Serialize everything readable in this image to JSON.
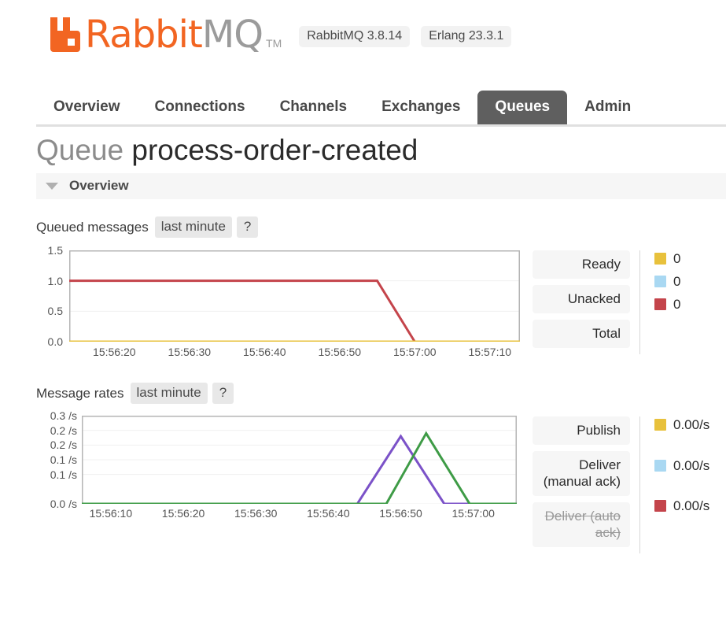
{
  "brand": {
    "name_part1": "Rabbit",
    "name_part2": "MQ",
    "trademark": "TM",
    "logo_icon": "rabbitmq-logo-icon",
    "orange": "#F26522",
    "grey": "#9b9b9b"
  },
  "versions": [
    {
      "label": "RabbitMQ 3.8.14"
    },
    {
      "label": "Erlang 23.3.1"
    }
  ],
  "nav": {
    "tabs": [
      {
        "label": "Overview",
        "active": false
      },
      {
        "label": "Connections",
        "active": false
      },
      {
        "label": "Channels",
        "active": false
      },
      {
        "label": "Exchanges",
        "active": false
      },
      {
        "label": "Queues",
        "active": true
      },
      {
        "label": "Admin",
        "active": false
      }
    ]
  },
  "page": {
    "title_prefix": "Queue",
    "queue_name": "process-order-created",
    "section": {
      "title": "Overview",
      "caret_icon": "caret-down-icon"
    }
  },
  "queued_messages": {
    "label": "Queued messages",
    "period": "last minute",
    "help": "?",
    "legend": [
      {
        "name": "Ready",
        "value": "0",
        "color": "#E8C13C",
        "disabled": false
      },
      {
        "name": "Unacked",
        "value": "0",
        "color": "#A9D8F2",
        "disabled": false
      },
      {
        "name": "Total",
        "value": "0",
        "color": "#C4444B",
        "disabled": false
      }
    ]
  },
  "message_rates": {
    "label": "Message rates",
    "period": "last minute",
    "help": "?",
    "legend": [
      {
        "name": "Publish",
        "value": "0.00/s",
        "color": "#E8C13C",
        "disabled": false
      },
      {
        "name": "Deliver (manual ack)",
        "value": "0.00/s",
        "color": "#A9D8F2",
        "disabled": false
      },
      {
        "name": "Deliver (auto ack)",
        "value": "0.00/s",
        "color": "#C4444B",
        "disabled": true
      }
    ]
  },
  "chart_data": [
    {
      "type": "line",
      "title": "Queued messages",
      "xlabel": "",
      "ylabel": "",
      "grid": true,
      "legend_position": "right",
      "ylim": [
        0,
        1.5
      ],
      "yticks": [
        "0.0",
        "0.5",
        "1.0",
        "1.5"
      ],
      "ytick_values": [
        0.0,
        0.5,
        1.0,
        1.5
      ],
      "xticks": [
        "15:56:20",
        "15:56:30",
        "15:56:40",
        "15:56:50",
        "15:57:00",
        "15:57:10"
      ],
      "xtick_values": [
        20,
        30,
        40,
        50,
        60,
        70
      ],
      "xlim": [
        14,
        74
      ],
      "series": [
        {
          "name": "Total",
          "color": "#C4444B",
          "x": [
            14,
            55,
            60,
            74
          ],
          "values": [
            1.0,
            1.0,
            0.0,
            0.0
          ]
        },
        {
          "name": "Unacked",
          "color": "#A9D8F2",
          "x": [
            14,
            74
          ],
          "values": [
            0.0,
            0.0
          ]
        },
        {
          "name": "Ready",
          "color": "#E8C13C",
          "x": [
            14,
            74
          ],
          "values": [
            0.0,
            0.0
          ]
        }
      ]
    },
    {
      "type": "line",
      "title": "Message rates",
      "xlabel": "",
      "ylabel": "/s",
      "grid": true,
      "legend_position": "right",
      "ylim": [
        0,
        0.3
      ],
      "yticks": [
        "0.3 /s",
        "0.2 /s",
        "0.2 /s",
        "0.1 /s",
        "0.1 /s",
        "0.0 /s"
      ],
      "ytick_values": [
        0.3,
        0.25,
        0.2,
        0.15,
        0.1,
        0.0
      ],
      "xticks": [
        "15:56:10",
        "15:56:20",
        "15:56:30",
        "15:56:40",
        "15:56:50",
        "15:57:00"
      ],
      "xtick_values": [
        10,
        20,
        30,
        40,
        50,
        60
      ],
      "xlim": [
        6,
        66
      ],
      "series": [
        {
          "name": "Publish",
          "color": "#7B52C8",
          "x": [
            6,
            44,
            50,
            56,
            66
          ],
          "values": [
            0.0,
            0.0,
            0.23,
            0.0,
            0.0
          ]
        },
        {
          "name": "Deliver (manual ack)",
          "color": "#3E9B46",
          "x": [
            6,
            48,
            53.5,
            59.5,
            66
          ],
          "values": [
            0.0,
            0.0,
            0.24,
            0.0,
            0.0
          ]
        }
      ]
    }
  ]
}
